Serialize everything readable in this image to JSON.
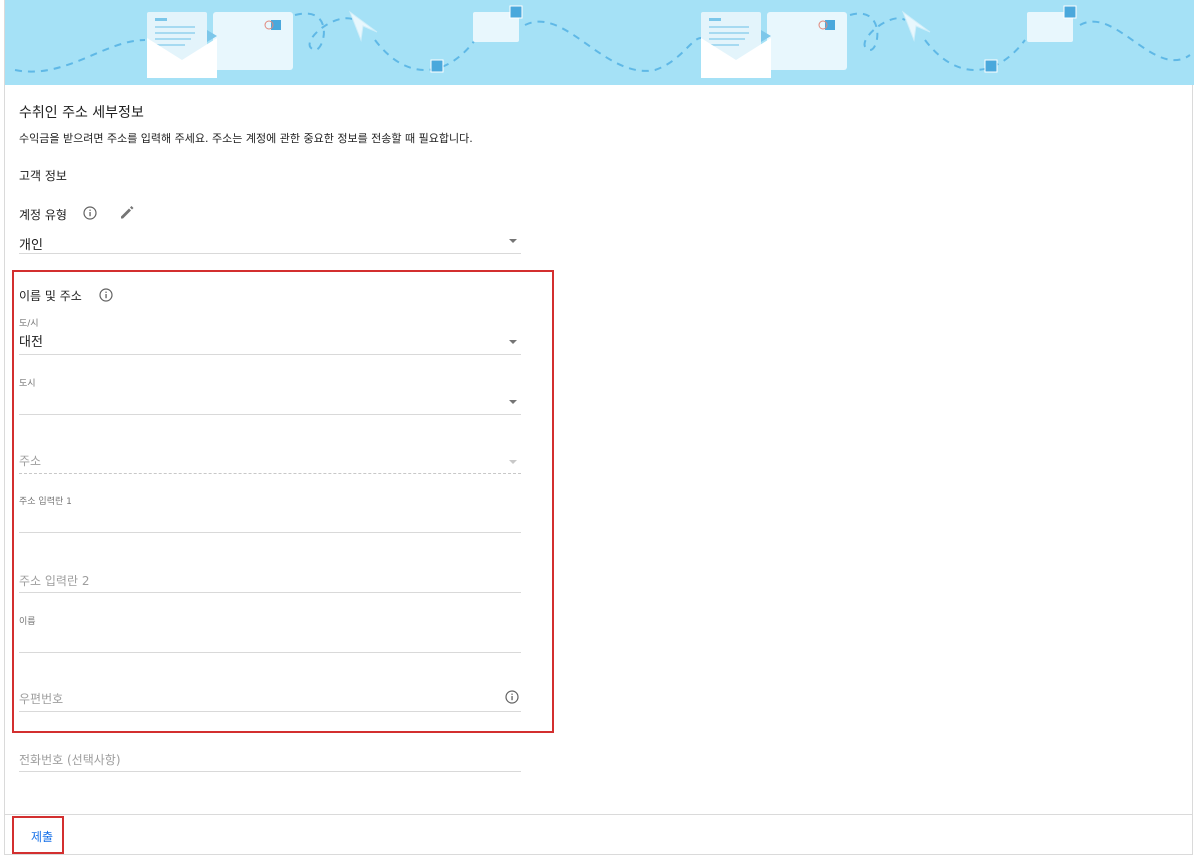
{
  "page": {
    "title": "수취인 주소 세부정보",
    "subtitle": "수익금을 받으려면 주소를 입력해 주세요. 주소는 계정에 관한 중요한 정보를 전송할 때 필요합니다.",
    "customer_section": "고객 정보"
  },
  "account_type": {
    "label": "계정 유형",
    "value": "개인",
    "info_icon": "info-icon",
    "edit_icon": "edit-icon"
  },
  "name_address": {
    "label": "이름 및 주소",
    "info_icon": "info-icon",
    "province": {
      "label": "도/시",
      "value": "대전"
    },
    "city": {
      "label": "도시",
      "value": ""
    },
    "district": {
      "placeholder": "주소"
    },
    "address1": {
      "label": "주소 입력란 1",
      "value": ""
    },
    "address2": {
      "placeholder": "주소 입력란 2"
    },
    "name": {
      "label": "이름",
      "value": ""
    },
    "postal": {
      "placeholder": "우편번호",
      "info_icon": "info-icon"
    }
  },
  "phone": {
    "placeholder": "전화번호 (선택사항)"
  },
  "footer": {
    "submit_label": "제출"
  },
  "colors": {
    "accent": "#1a73e8",
    "highlight": "#d32f2f",
    "banner": "#a5e1f6"
  }
}
